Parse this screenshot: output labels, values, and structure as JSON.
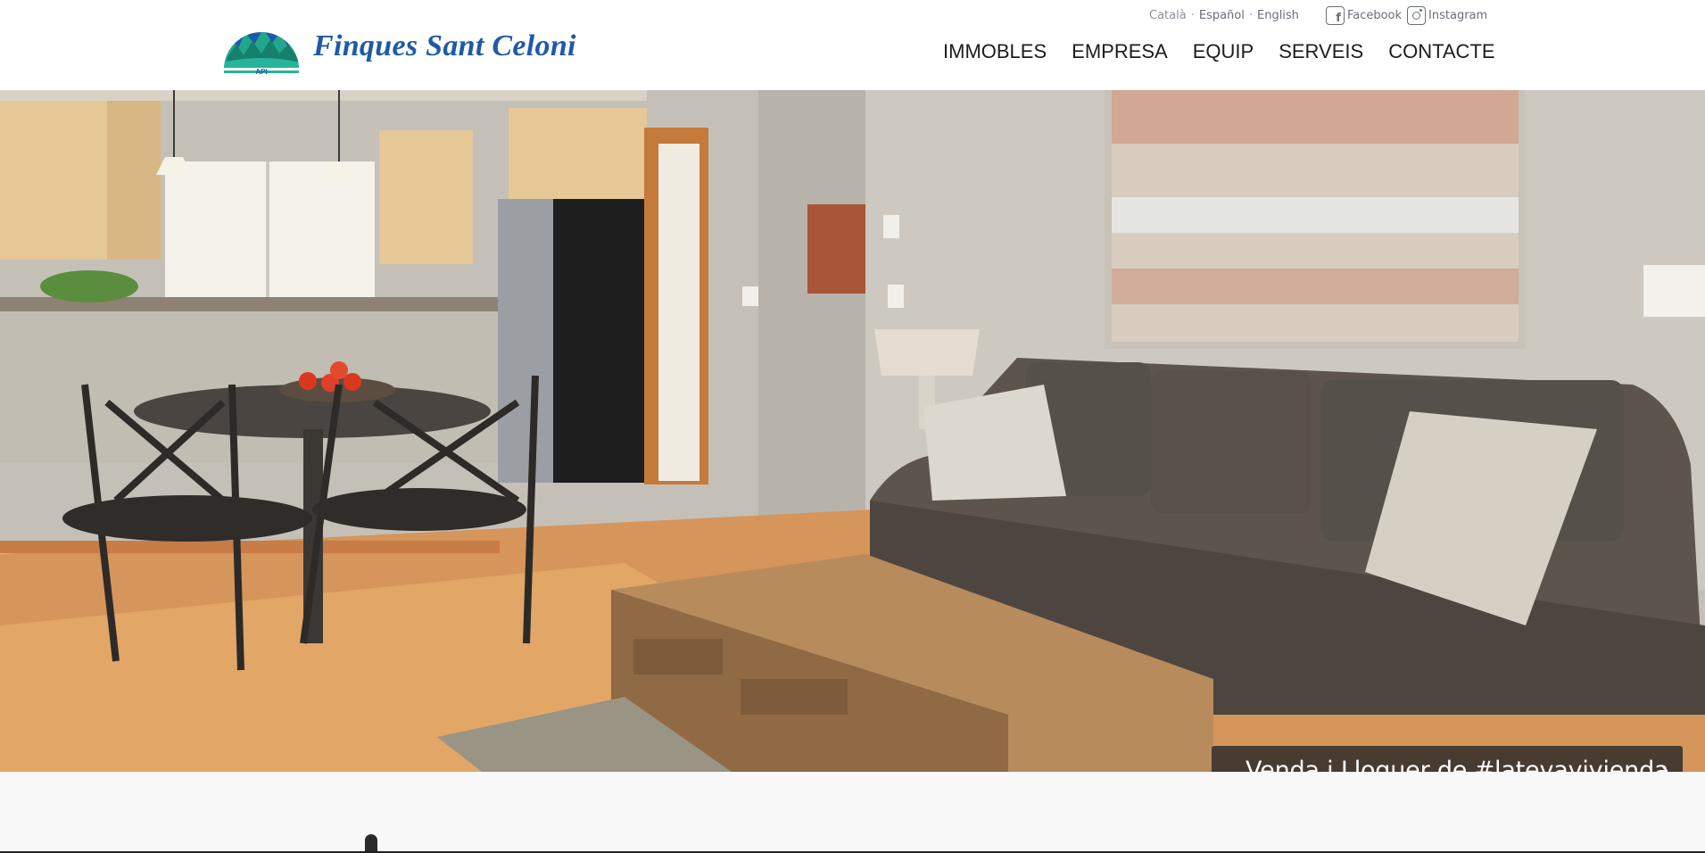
{
  "brand": {
    "name": "Finques Sant Celoni",
    "logo_tag": "API",
    "color": "#1f5aa6",
    "logo_green": "#1e9e8a"
  },
  "languages": [
    "Català",
    "Español",
    "English"
  ],
  "social": [
    {
      "label": "Facebook",
      "icon": "facebook-icon"
    },
    {
      "label": "Instagram",
      "icon": "instagram-icon"
    }
  ],
  "nav": [
    "IMMOBLES",
    "EMPRESA",
    "EQUIP",
    "SERVEIS",
    "CONTACTE"
  ],
  "hero": {
    "caption": "Venda i Lloguer de #latevavivienda",
    "arrow": "›",
    "slides": 2
  }
}
